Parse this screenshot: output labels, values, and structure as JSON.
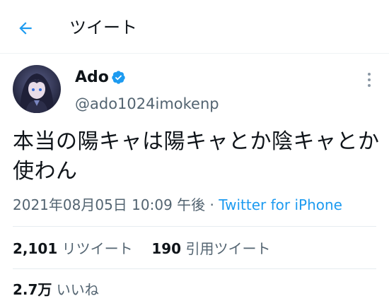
{
  "header": {
    "title": "ツイート",
    "back_icon": "arrow-left-icon",
    "accent_color": "#1d9bf0"
  },
  "author": {
    "display_name": "Ado",
    "handle": "@ado1024imokenp",
    "verified": true,
    "verified_icon": "verified-badge-icon"
  },
  "tweet": {
    "text": "本当の陽キャは陽キャとか陰キャとか使わん",
    "timestamp": "2021年08月05日 10:09 午後",
    "separator": "·",
    "source": "Twitter for iPhone"
  },
  "stats": {
    "retweets_count": "2,101",
    "retweets_label": "リツイート",
    "quotes_count": "190",
    "quotes_label": "引用ツイート",
    "likes_count": "2.7万",
    "likes_label": "いいね"
  }
}
